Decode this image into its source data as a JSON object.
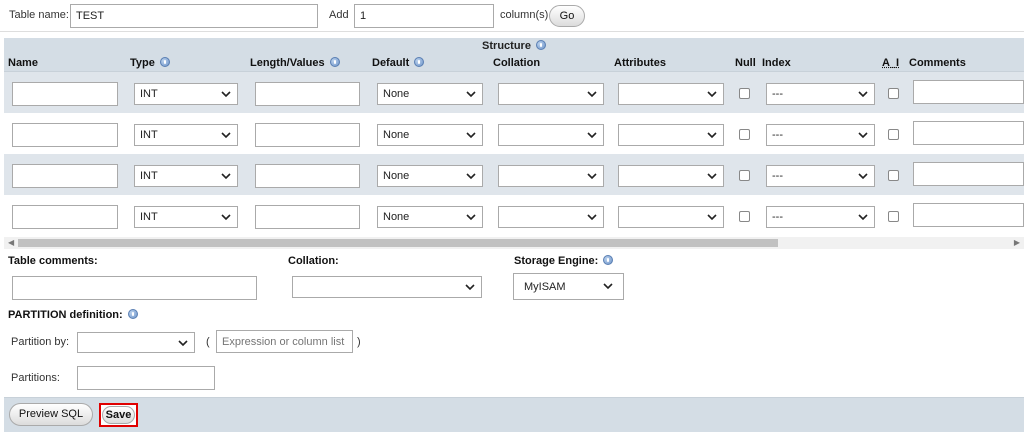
{
  "top": {
    "table_name_label": "Table name:",
    "table_name_value": "TEST",
    "add_label": "Add",
    "add_value": "1",
    "columns_label": "column(s)",
    "go_label": "Go"
  },
  "structure": {
    "title": "Structure",
    "headers": {
      "name": "Name",
      "type": "Type",
      "length": "Length/Values",
      "default": "Default",
      "collation": "Collation",
      "attributes": "Attributes",
      "null": "Null",
      "index": "Index",
      "ai": "A_I",
      "comments": "Comments"
    },
    "rows": [
      {
        "name": "",
        "type": "INT",
        "length": "",
        "default": "None",
        "collation": "",
        "attributes": "",
        "index": "---"
      },
      {
        "name": "",
        "type": "INT",
        "length": "",
        "default": "None",
        "collation": "",
        "attributes": "",
        "index": "---"
      },
      {
        "name": "",
        "type": "INT",
        "length": "",
        "default": "None",
        "collation": "",
        "attributes": "",
        "index": "---"
      },
      {
        "name": "",
        "type": "INT",
        "length": "",
        "default": "None",
        "collation": "",
        "attributes": "",
        "index": "---"
      }
    ]
  },
  "table_options": {
    "comments_label": "Table comments:",
    "collation_label": "Collation:",
    "collation_value": "",
    "engine_label": "Storage Engine:",
    "engine_value": "MyISAM"
  },
  "partition": {
    "title": "PARTITION definition:",
    "partition_by_label": "Partition by:",
    "partition_by_value": "",
    "open_paren": "(",
    "close_paren": ")",
    "expression_placeholder": "Expression or column list",
    "partitions_label": "Partitions:",
    "partitions_value": ""
  },
  "actions": {
    "preview_sql": "Preview SQL",
    "save": "Save"
  },
  "icons": {
    "help": "help-icon",
    "dropdown": "chevron-down-icon"
  }
}
